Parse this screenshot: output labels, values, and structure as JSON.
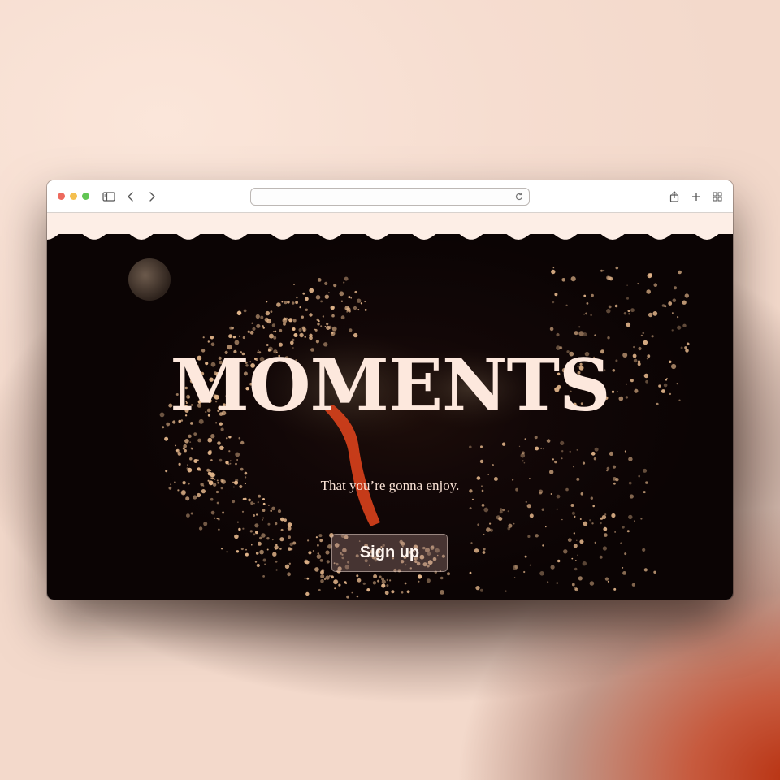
{
  "hero": {
    "title": "MOMENTS",
    "subtitle": "That you’re gonna enjoy.",
    "cta_label": "Sign up"
  },
  "icons": {
    "sidebar": "sidebar-icon",
    "back": "chevron-left-icon",
    "forward": "chevron-right-icon",
    "reload": "reload-icon",
    "share": "share-icon",
    "new_tab": "plus-icon",
    "tabs": "tab-grid-icon"
  },
  "colors": {
    "hero_background": "#0b0404",
    "title": "#fde8dd",
    "accent_sparks": "#e7b98e",
    "figure": "#d9411c",
    "page_background": "#fdeee6"
  }
}
